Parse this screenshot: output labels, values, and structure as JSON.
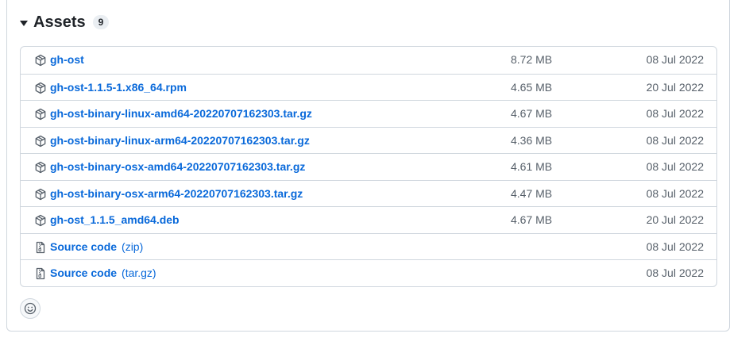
{
  "assets": {
    "title": "Assets",
    "count": "9"
  },
  "rows": [
    {
      "name": "gh-ost",
      "size": "8.72 MB",
      "date": "08 Jul 2022",
      "icon": "package-icon"
    },
    {
      "name": "gh-ost-1.1.5-1.x86_64.rpm",
      "size": "4.65 MB",
      "date": "20 Jul 2022",
      "icon": "package-icon"
    },
    {
      "name": "gh-ost-binary-linux-amd64-20220707162303.tar.gz",
      "size": "4.67 MB",
      "date": "08 Jul 2022",
      "icon": "package-icon"
    },
    {
      "name": "gh-ost-binary-linux-arm64-20220707162303.tar.gz",
      "size": "4.36 MB",
      "date": "08 Jul 2022",
      "icon": "package-icon"
    },
    {
      "name": "gh-ost-binary-osx-amd64-20220707162303.tar.gz",
      "size": "4.61 MB",
      "date": "08 Jul 2022",
      "icon": "package-icon"
    },
    {
      "name": "gh-ost-binary-osx-arm64-20220707162303.tar.gz",
      "size": "4.47 MB",
      "date": "08 Jul 2022",
      "icon": "package-icon"
    },
    {
      "name": "gh-ost_1.1.5_amd64.deb",
      "size": "4.67 MB",
      "date": "20 Jul 2022",
      "icon": "package-icon"
    },
    {
      "name": "Source code",
      "suffix": "(zip)",
      "date": "08 Jul 2022",
      "icon": "file-zip-icon"
    },
    {
      "name": "Source code",
      "suffix": "(tar.gz)",
      "date": "08 Jul 2022",
      "icon": "file-zip-icon"
    }
  ],
  "colors": {
    "link": "#0969da",
    "muted": "#57606a",
    "border": "#d0d7de"
  }
}
